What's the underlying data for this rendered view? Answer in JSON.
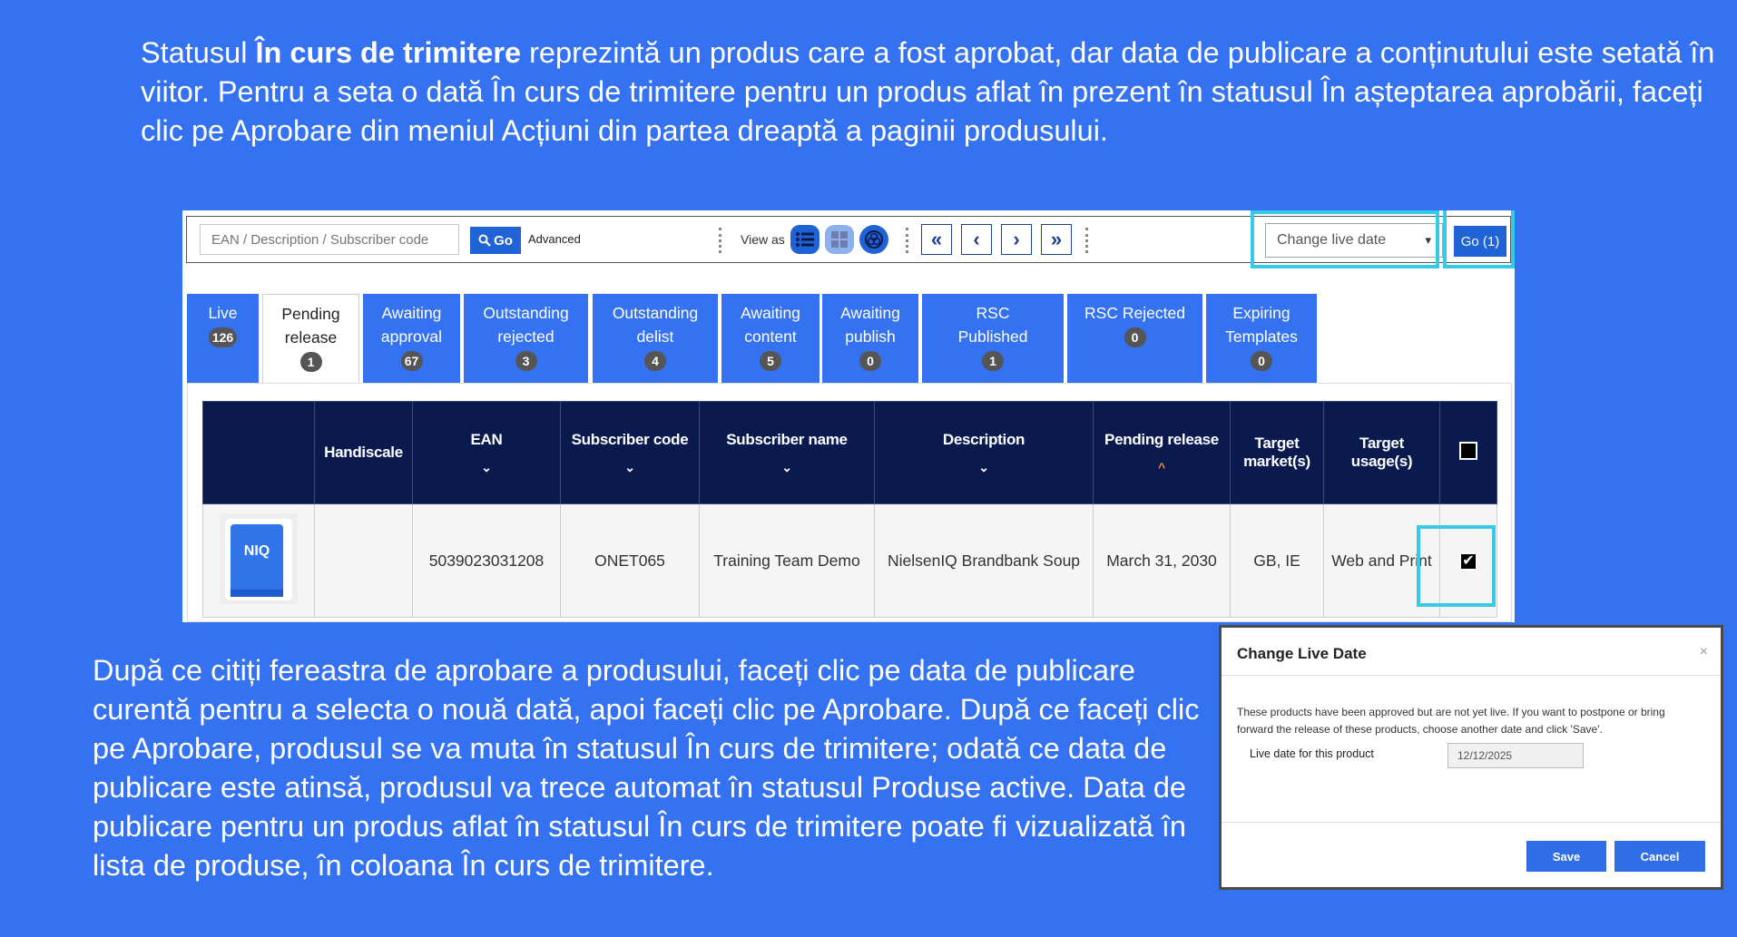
{
  "intro": {
    "t1": "Statusul ",
    "bold": "În curs de trimitere",
    "t2": " reprezintă un produs care a fost aprobat, dar data de publicare a conținutului este setată în viitor. Pentru a seta o dată În curs de trimitere pentru un produs aflat în prezent în statusul În așteptarea aprobării, faceți clic pe Aprobare din meniul Acțiuni din partea dreaptă a paginii produsului."
  },
  "outro": "După ce citiți fereastra de aprobare a produsului, faceți clic pe data de publicare curentă pentru a selecta o nouă dată, apoi faceți clic pe Aprobare. După ce faceți clic pe Aprobare, produsul se va muta în statusul În curs de trimitere; odată ce data de publicare este atinsă, produsul va trece automat în statusul Produse active. Data de publicare pentru un produs aflat în statusul În curs de trimitere poate fi vizualizată în lista de produse, în coloana În curs de trimitere.",
  "toolbar": {
    "search_placeholder": "EAN / Description / Subscriber code",
    "go_label": "Go",
    "advanced_label": "Advanced",
    "view_as_label": "View as",
    "live_select_label": "Change live date",
    "go_count_label": "Go (1)"
  },
  "tabs": [
    {
      "l1": "Live",
      "l2": "",
      "count": "126"
    },
    {
      "l1": "Pending",
      "l2": "release",
      "count": "1"
    },
    {
      "l1": "Awaiting",
      "l2": "approval",
      "count": "67"
    },
    {
      "l1": "Outstanding",
      "l2": "rejected",
      "count": "3"
    },
    {
      "l1": "Outstanding",
      "l2": "delist",
      "count": "4"
    },
    {
      "l1": "Awaiting",
      "l2": "content",
      "count": "5"
    },
    {
      "l1": "Awaiting",
      "l2": "publish",
      "count": "0"
    },
    {
      "l1": "RSC",
      "l2": "Published",
      "count": "1"
    },
    {
      "l1": "RSC Rejected",
      "l2": "",
      "count": "0"
    },
    {
      "l1": "Expiring",
      "l2": "Templates",
      "count": "0"
    }
  ],
  "table": {
    "headers": {
      "handiscale": "Handiscale",
      "ean": "EAN",
      "subscriber_code": "Subscriber code",
      "subscriber_name": "Subscriber name",
      "description": "Description",
      "pending_release": "Pending release",
      "target_markets": "Target market(s)",
      "target_usages": "Target usage(s)"
    },
    "row": {
      "thumb_logo": "NIQ",
      "ean": "5039023031208",
      "subscriber_code": "ONET065",
      "subscriber_name": "Training Team Demo",
      "description": "NielsenIQ Brandbank Soup",
      "pending_release": "March 31, 2030",
      "target_markets": "GB, IE",
      "target_usages": "Web and Print"
    }
  },
  "modal": {
    "title": "Change Live Date",
    "close": "×",
    "text": "These products have been approved but are not yet live. If you want to postpone or bring forward the release of these products, choose another date and click 'Save'.",
    "date_label": "Live date for this product",
    "date_value": "12/12/2025",
    "save_label": "Save",
    "cancel_label": "Cancel"
  },
  "colors": {
    "background": "#3572f2",
    "header_navy": "#0a1a4f",
    "highlight": "#37c9ea",
    "button_blue": "#1f63d6"
  }
}
